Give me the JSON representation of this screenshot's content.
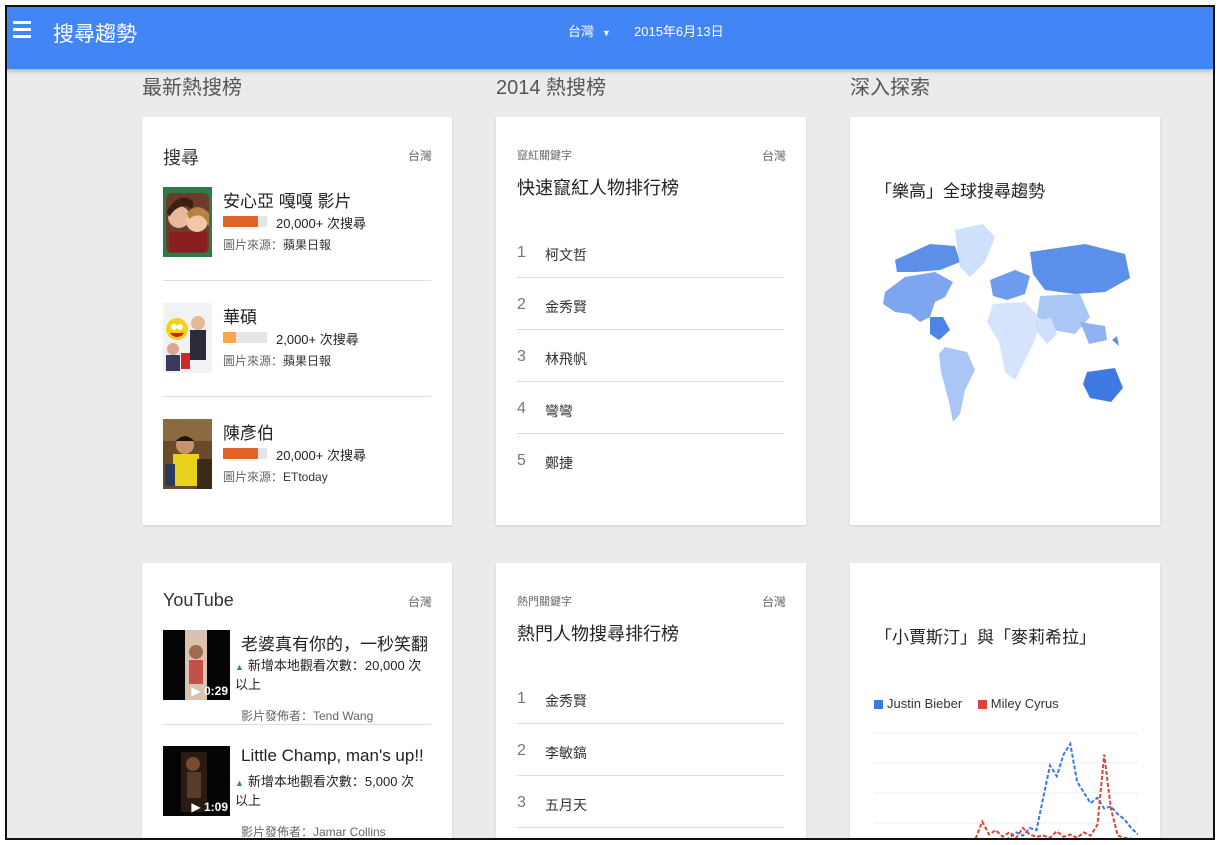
{
  "header": {
    "title": "搜尋趨勢",
    "region": "台灣",
    "date": "2015年6月13日"
  },
  "columns": {
    "hot": "最新熱搜榜",
    "year": "2014 熱搜榜",
    "explore": "深入探索"
  },
  "search_card": {
    "title": "搜尋",
    "region": "台灣",
    "items": [
      {
        "name": "安心亞 嘎嘎 影片",
        "count": "20,000+ 次搜尋",
        "level": 0.8,
        "color": "#e06428",
        "source_label": "圖片來源：",
        "source": "蘋果日報"
      },
      {
        "name": "華碩",
        "count": "2,000+ 次搜尋",
        "level": 0.3,
        "color": "#f4a94a",
        "source_label": "圖片來源：",
        "source": "蘋果日報"
      },
      {
        "name": "陳彥伯",
        "count": "20,000+ 次搜尋",
        "level": 0.8,
        "color": "#e06428",
        "source_label": "圖片來源：",
        "source": "ETtoday"
      }
    ]
  },
  "rank_card_1": {
    "subtitle": "竄紅關鍵字",
    "region": "台灣",
    "heading": "快速竄紅人物排行榜",
    "items": [
      {
        "rank": "1",
        "name": "柯文哲"
      },
      {
        "rank": "2",
        "name": "金秀賢"
      },
      {
        "rank": "3",
        "name": "林飛帆"
      },
      {
        "rank": "4",
        "name": "彎彎"
      },
      {
        "rank": "5",
        "name": "鄭捷"
      }
    ]
  },
  "map_card": {
    "title": "「樂高」全球搜尋趨勢"
  },
  "youtube_card": {
    "title": "YouTube",
    "region": "台灣",
    "items": [
      {
        "title": "老婆真有你的，一秒笑翻",
        "duration": "▶ 0:29",
        "views": "新增本地觀看次數：20,000 次以上",
        "publisher": "影片發佈者：Tend Wang"
      },
      {
        "title": "Little Champ, man's up!!",
        "duration": "▶ 1:09",
        "views": "新增本地觀看次數：5,000 次以上",
        "publisher": "影片發佈者：Jamar Collins"
      }
    ]
  },
  "rank_card_2": {
    "subtitle": "熱門關鍵字",
    "region": "台灣",
    "heading": "熱門人物搜尋排行榜",
    "items": [
      {
        "rank": "1",
        "name": "金秀賢"
      },
      {
        "rank": "2",
        "name": "李敏鎬"
      },
      {
        "rank": "3",
        "name": "五月天"
      }
    ]
  },
  "compare_card": {
    "title": "「小賈斯汀」與「麥莉希拉」",
    "legend": [
      {
        "name": "Justin Bieber",
        "color": "#3b78e7"
      },
      {
        "name": "Miley Cyrus",
        "color": "#db4437"
      }
    ]
  },
  "chart_data": {
    "type": "line",
    "x": [
      0,
      1,
      2,
      3,
      4,
      5,
      6,
      7,
      8,
      9,
      10,
      11,
      12,
      13,
      14,
      15,
      16,
      17,
      18,
      19,
      20,
      21,
      22,
      23,
      24,
      25,
      26,
      27,
      28,
      29,
      30,
      31,
      32,
      33,
      34,
      35,
      36,
      37,
      38,
      39
    ],
    "series": [
      {
        "name": "Justin Bieber",
        "color": "#3b78e7",
        "values": [
          0,
          0,
          0,
          0,
          0,
          0,
          0,
          0,
          0,
          0,
          0,
          0,
          0,
          0,
          0,
          0,
          0,
          0,
          0,
          0,
          3,
          8,
          5,
          12,
          10,
          40,
          70,
          60,
          80,
          90,
          55,
          45,
          35,
          40,
          30,
          32,
          25,
          20,
          12,
          6
        ]
      },
      {
        "name": "Miley Cyrus",
        "color": "#db4437",
        "values": [
          0,
          0,
          0,
          0,
          0,
          0,
          0,
          0,
          0,
          0,
          0,
          0,
          0,
          0,
          0,
          2,
          18,
          6,
          10,
          4,
          8,
          3,
          12,
          6,
          4,
          5,
          3,
          9,
          4,
          6,
          3,
          8,
          5,
          15,
          80,
          30,
          5,
          3,
          2,
          1
        ]
      }
    ]
  }
}
